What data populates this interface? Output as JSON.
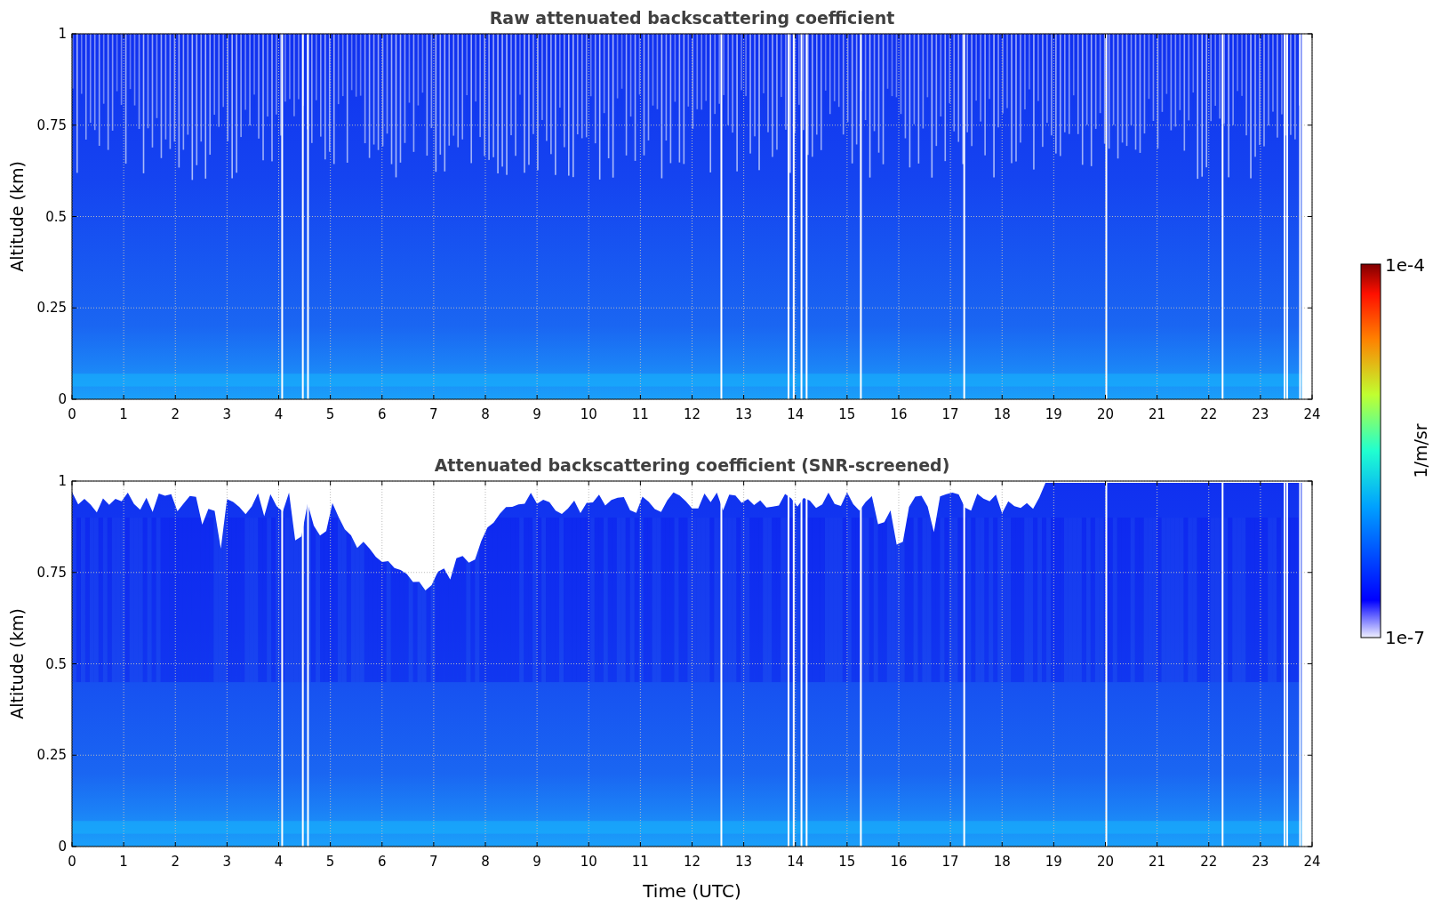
{
  "panels": [
    {
      "title": "Raw attenuated backscattering coefficient",
      "ylabel": "Altitude (km)",
      "screened": false,
      "yticks": [
        "1",
        "0.75",
        "0.5",
        "0.25",
        "0"
      ],
      "xticks": [
        "0",
        "1",
        "2",
        "3",
        "4",
        "5",
        "6",
        "7",
        "8",
        "9",
        "10",
        "11",
        "12",
        "13",
        "14",
        "15",
        "16",
        "17",
        "18",
        "19",
        "20",
        "21",
        "22",
        "23",
        "24"
      ]
    },
    {
      "title": "Attenuated backscattering coefficient (SNR-screened)",
      "ylabel": "Altitude (km)",
      "screened": true,
      "yticks": [
        "1",
        "0.75",
        "0.5",
        "0.25",
        "0"
      ],
      "xticks": [
        "0",
        "1",
        "2",
        "3",
        "4",
        "5",
        "6",
        "7",
        "8",
        "9",
        "10",
        "11",
        "12",
        "13",
        "14",
        "15",
        "16",
        "17",
        "18",
        "19",
        "20",
        "21",
        "22",
        "23",
        "24"
      ],
      "xlabel": "Time (UTC)"
    }
  ],
  "colorbar": {
    "max_label": "1e-4",
    "min_label": "1e-7",
    "label": "1/m/sr"
  }
}
